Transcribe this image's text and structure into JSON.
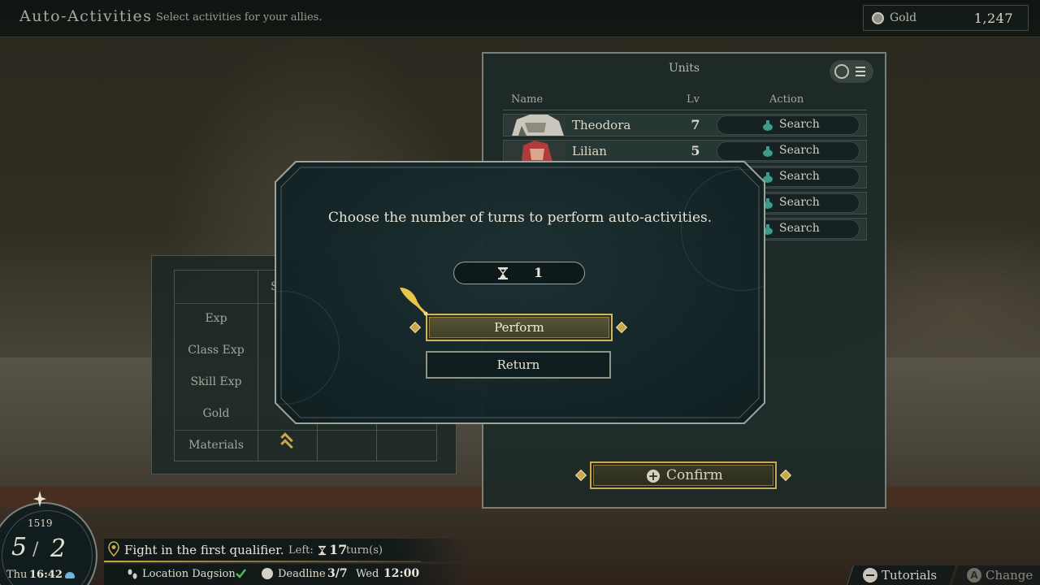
{
  "topbar": {
    "title": "Auto-Activities",
    "subtitle": "Select activities for your allies.",
    "gold_label": "Gold",
    "gold_value": "1,247"
  },
  "units_panel": {
    "header": "Units",
    "columns": {
      "name": "Name",
      "lv": "Lv",
      "action": "Action"
    },
    "rows": [
      {
        "name": "Theodora",
        "lv": "7",
        "action": "Search"
      },
      {
        "name": "Lilian",
        "lv": "5",
        "action": "Search"
      },
      {
        "name": "",
        "lv": "",
        "action": "Search"
      },
      {
        "name": "",
        "lv": "",
        "action": "Search"
      },
      {
        "name": "",
        "lv": "",
        "action": "Search"
      }
    ],
    "confirm_label": "Confirm"
  },
  "stats_panel": {
    "header_partial": "S",
    "rows": [
      "Exp",
      "Class Exp",
      "Skill Exp",
      "Gold",
      "Materials"
    ]
  },
  "modal": {
    "prompt": "Choose the number of turns to perform auto-activities.",
    "turn_count": "1",
    "perform_label": "Perform",
    "return_label": "Return"
  },
  "hud": {
    "year": "1519",
    "month": "5",
    "day": "2",
    "weekday": "Thu",
    "time": "16:42",
    "objective": "Fight in the first qualifier.",
    "left_label": "Left:",
    "left_turns": "17",
    "left_unit": "turn(s)",
    "location": "Location Dagsion",
    "deadline_label": "Deadline",
    "deadline_date": "3/7",
    "deadline_weekday": "Wed",
    "deadline_time": "12:00"
  },
  "footer": {
    "tutorials_label": "Tutorials",
    "change_label": "Change",
    "change_key": "A"
  },
  "colors": {
    "accent_gold": "#c9a84e",
    "panel_teal": "#1c3032",
    "flask_teal": "#3e9a8a"
  }
}
